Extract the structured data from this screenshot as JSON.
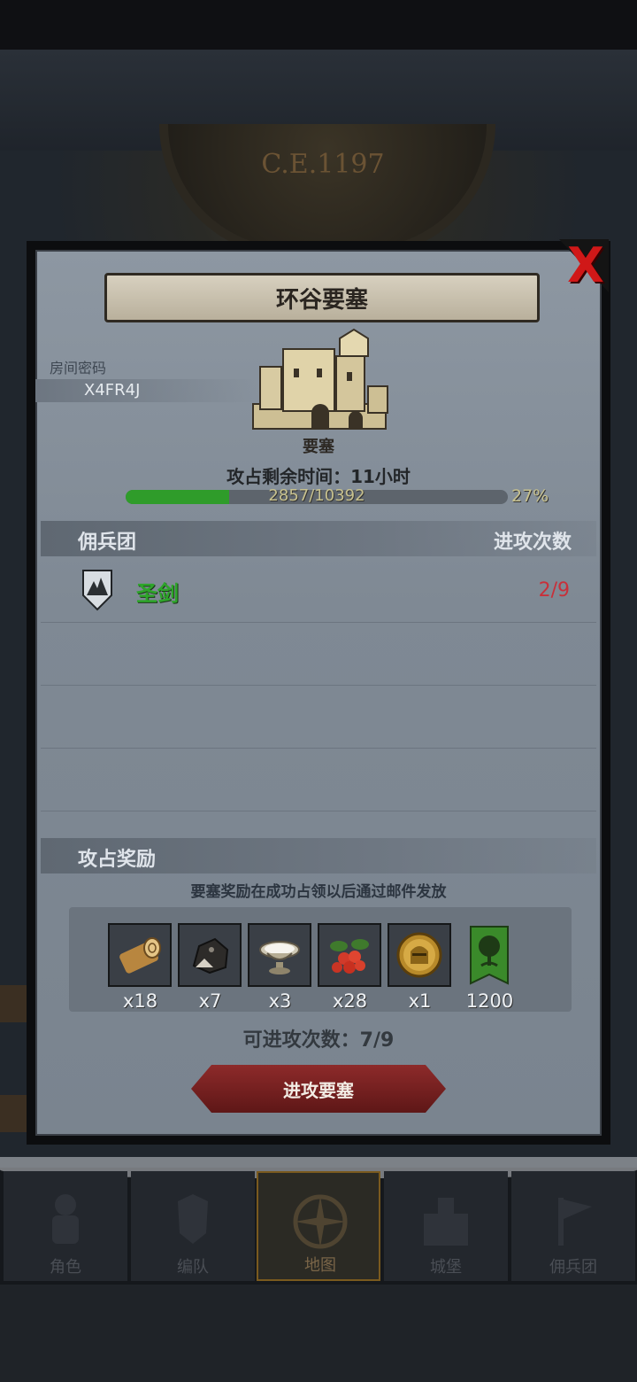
{
  "era": "C.E.1197",
  "dialog": {
    "title": "环谷要塞",
    "close_label": "X",
    "room_code_label": "房间密码",
    "room_code_value": "X4FR4J",
    "building_name": "要塞",
    "remaining_time": "攻占剩余时间：11小时",
    "progress_text": "2857/10392",
    "progress_pct": "27%",
    "progress_fraction": 0.27,
    "mercenary_header": "佣兵团",
    "attack_count_header": "进攻次数",
    "mercenaries": [
      {
        "name": "圣剑",
        "count": "2/9",
        "icon": "mountain-shield-icon"
      }
    ],
    "reward_header": "攻占奖励",
    "reward_note": "要塞奖励在成功占领以后通过邮件发放",
    "rewards": [
      {
        "icon": "wood-log-icon",
        "qty": "x18"
      },
      {
        "icon": "ore-rock-icon",
        "qty": "x7"
      },
      {
        "icon": "salt-bowl-icon",
        "qty": "x3"
      },
      {
        "icon": "berries-icon",
        "qty": "x28"
      },
      {
        "icon": "knight-helmet-coin-icon",
        "qty": "x1"
      },
      {
        "icon": "tree-banner-icon",
        "qty": "1200"
      }
    ],
    "attempts": "可进攻次数：7/9",
    "attack_button": "进攻要塞"
  },
  "nav": [
    {
      "label": "角色",
      "icon": "knight-icon",
      "active": false
    },
    {
      "label": "编队",
      "icon": "armor-icon",
      "active": false
    },
    {
      "label": "地图",
      "icon": "compass-icon",
      "active": true
    },
    {
      "label": "城堡",
      "icon": "castle-icon",
      "active": false
    },
    {
      "label": "佣兵团",
      "icon": "mercenary-icon",
      "active": false
    }
  ],
  "colors": {
    "progress_fill": "#2f9c2a",
    "mercenary_name": "#2ea52a",
    "attack_count": "#c8303a",
    "close_x": "#d01818",
    "attack_button": "#8d2a2a"
  }
}
